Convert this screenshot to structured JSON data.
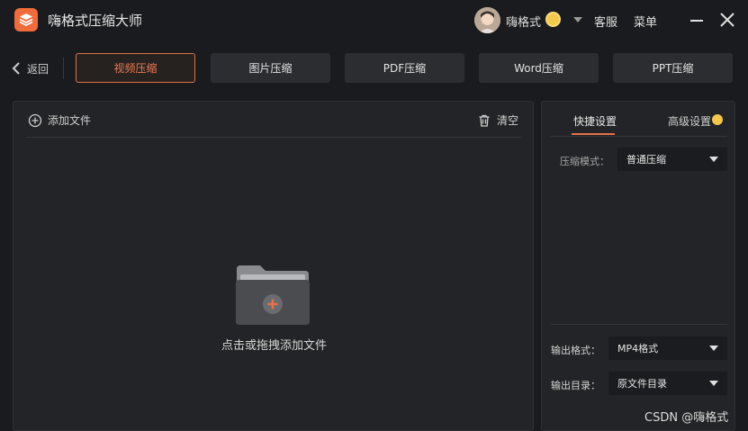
{
  "app": {
    "title": "嗨格式压缩大师"
  },
  "user": {
    "name": "嗨格式"
  },
  "header": {
    "service": "客服",
    "menu": "菜单"
  },
  "nav": {
    "back": "返回"
  },
  "tabs": [
    {
      "label": "视频压缩",
      "active": true
    },
    {
      "label": "图片压缩",
      "active": false
    },
    {
      "label": "PDF压缩",
      "active": false
    },
    {
      "label": "Word压缩",
      "active": false
    },
    {
      "label": "PPT压缩",
      "active": false
    }
  ],
  "file_panel": {
    "add_file": "添加文件",
    "clear": "清空",
    "drop_hint": "点击或拖拽添加文件"
  },
  "settings": {
    "tab_quick": "快捷设置",
    "tab_advanced": "高级设置",
    "mode_label": "压缩模式：",
    "mode_value": "普通压缩",
    "format_label": "输出格式：",
    "format_value": "MP4格式",
    "dir_label": "输出目录：",
    "dir_value": "原文件目录"
  },
  "watermark": "CSDN @嗨格式",
  "colors": {
    "accent": "#e4704a",
    "background": "#1a1b1e",
    "panel": "#232427",
    "badge": "#f2c94c"
  }
}
